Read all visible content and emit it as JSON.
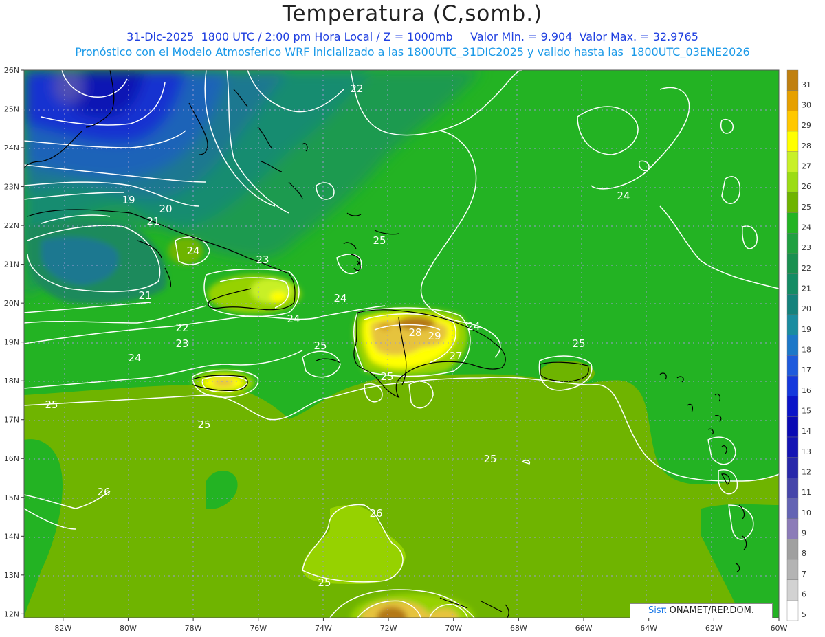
{
  "header": {
    "title": "Temperatura (C,somb.)",
    "subtitle_line1": "31-Dic-2025  1800 UTC / 2:00 pm Hora Local / Z = 1000mb     Valor Min. = 9.904  Valor Max. = 32.9765",
    "subtitle_line2": "Pronóstico con el Modelo Atmosferico WRF inicializado a las 1800UTC_31DIC2025 y valido hasta las  1800UTC_03ENE2026"
  },
  "map": {
    "lon_ticks": [
      "82W",
      "80W",
      "78W",
      "76W",
      "74W",
      "72W",
      "70W",
      "68W",
      "66W",
      "64W",
      "62W",
      "60W"
    ],
    "lat_ticks": [
      "26N",
      "25N",
      "24N",
      "23N",
      "22N",
      "21N",
      "20N",
      "19N",
      "18N",
      "17N",
      "16N",
      "15N",
      "14N",
      "13N",
      "12N"
    ],
    "lon_range": [
      -83.2,
      -60.0
    ],
    "lat_range": [
      11.9,
      26.0
    ],
    "contour_labels": [
      "22",
      "24",
      "19",
      "20",
      "21",
      "24",
      "23",
      "21",
      "24",
      "24",
      "22",
      "23",
      "24",
      "25",
      "24",
      "28",
      "29",
      "25",
      "27",
      "25",
      "25",
      "25",
      "25",
      "25",
      "26",
      "26",
      "25"
    ],
    "colors": {
      "ocean_24": "#23b323",
      "ocean_25": "#6fb400",
      "ocean_26": "#96d200",
      "cool_21": "#1c8c5a",
      "cool_20": "#1a7888",
      "cool_18": "#1c6ab4",
      "cold_15": "#0a2ab4",
      "cold_11": "#5a5ab4",
      "hot_28": "#e6c33c",
      "hot_30": "#d7a21e",
      "hot_31": "#b47817",
      "grid": "#9b9bd2",
      "coast": "#000000",
      "contour": "#ffffff"
    }
  },
  "colorbar": {
    "levels": [
      "31",
      "30",
      "29",
      "28",
      "27",
      "26",
      "25",
      "24",
      "23",
      "22",
      "21",
      "20",
      "19",
      "18",
      "17",
      "16",
      "15",
      "14",
      "13",
      "12",
      "11",
      "10",
      "9",
      "8",
      "7",
      "6",
      "5"
    ],
    "colors": [
      "#c08010",
      "#e6a000",
      "#ffc800",
      "#ffff00",
      "#c8f028",
      "#9bdc14",
      "#6eb400",
      "#23b423",
      "#20a040",
      "#1a9050",
      "#148c64",
      "#14827c",
      "#1a8ca0",
      "#1c78c8",
      "#1e5adc",
      "#1438dc",
      "#0a14c8",
      "#0a0ab4",
      "#1414b4",
      "#2828aa",
      "#4646aa",
      "#6464b4",
      "#8c7cb8",
      "#a0a0a0",
      "#b4b4b4",
      "#d2d2d2",
      "#ffffff"
    ]
  },
  "credit": {
    "brand": "Sisπ",
    "text": " ONAMET/REP.DOM."
  }
}
